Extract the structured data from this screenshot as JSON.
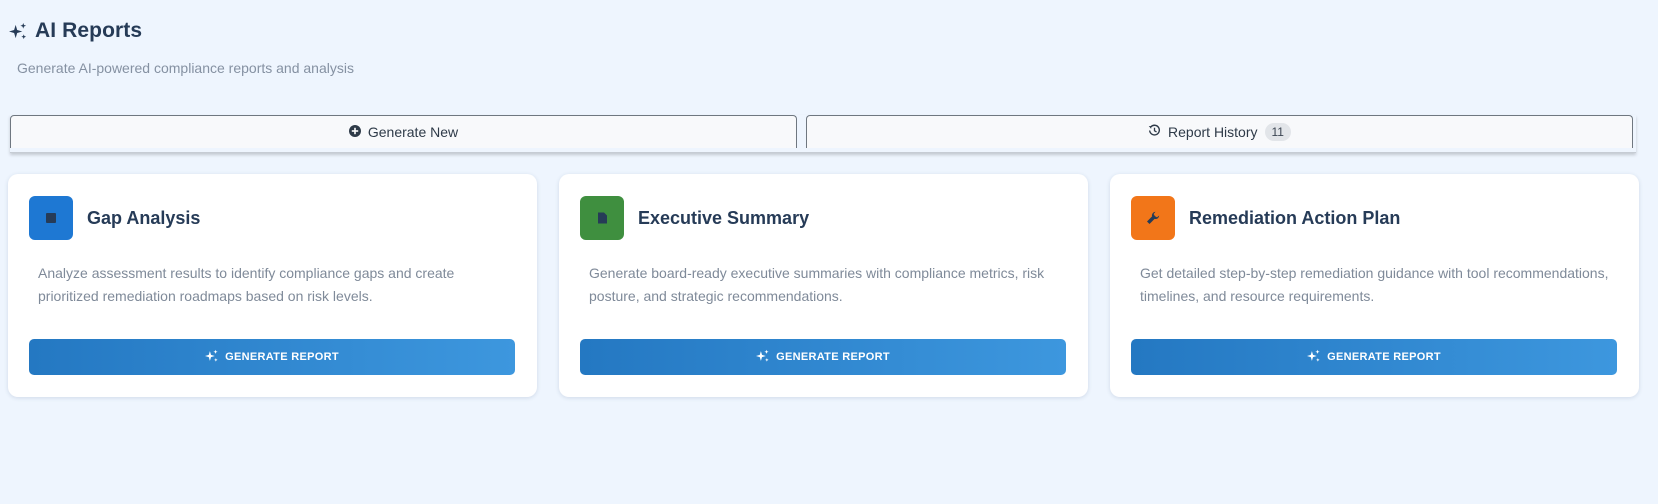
{
  "header": {
    "title": "AI Reports",
    "subtitle": "Generate AI-powered compliance reports and analysis",
    "icon": "sparkles-icon"
  },
  "tabs": [
    {
      "label": "Generate New",
      "icon": "plus-circle-icon"
    },
    {
      "label": "Report History",
      "icon": "history-icon",
      "count": "11"
    }
  ],
  "cards": [
    {
      "title": "Gap Analysis",
      "description": "Analyze assessment results to identify compliance gaps and create prioritized remediation roadmaps based on risk levels.",
      "button_label": "GENERATE REPORT",
      "icon": "chart-icon",
      "color": "#1e78d3"
    },
    {
      "title": "Executive Summary",
      "description": "Generate board-ready executive summaries with compliance metrics, risk posture, and strategic recommendations.",
      "button_label": "GENERATE REPORT",
      "icon": "document-icon",
      "color": "#3f8f3f"
    },
    {
      "title": "Remediation Action Plan",
      "description": "Get detailed step-by-step remediation guidance with tool recommendations, timelines, and resource requirements.",
      "button_label": "GENERATE REPORT",
      "icon": "wrench-icon",
      "color": "#f27619"
    }
  ],
  "colors": {
    "background": "#eef5fe",
    "text_primary": "#263b57",
    "button_gradient_start": "#2478c2",
    "button_gradient_end": "#3d97de"
  }
}
